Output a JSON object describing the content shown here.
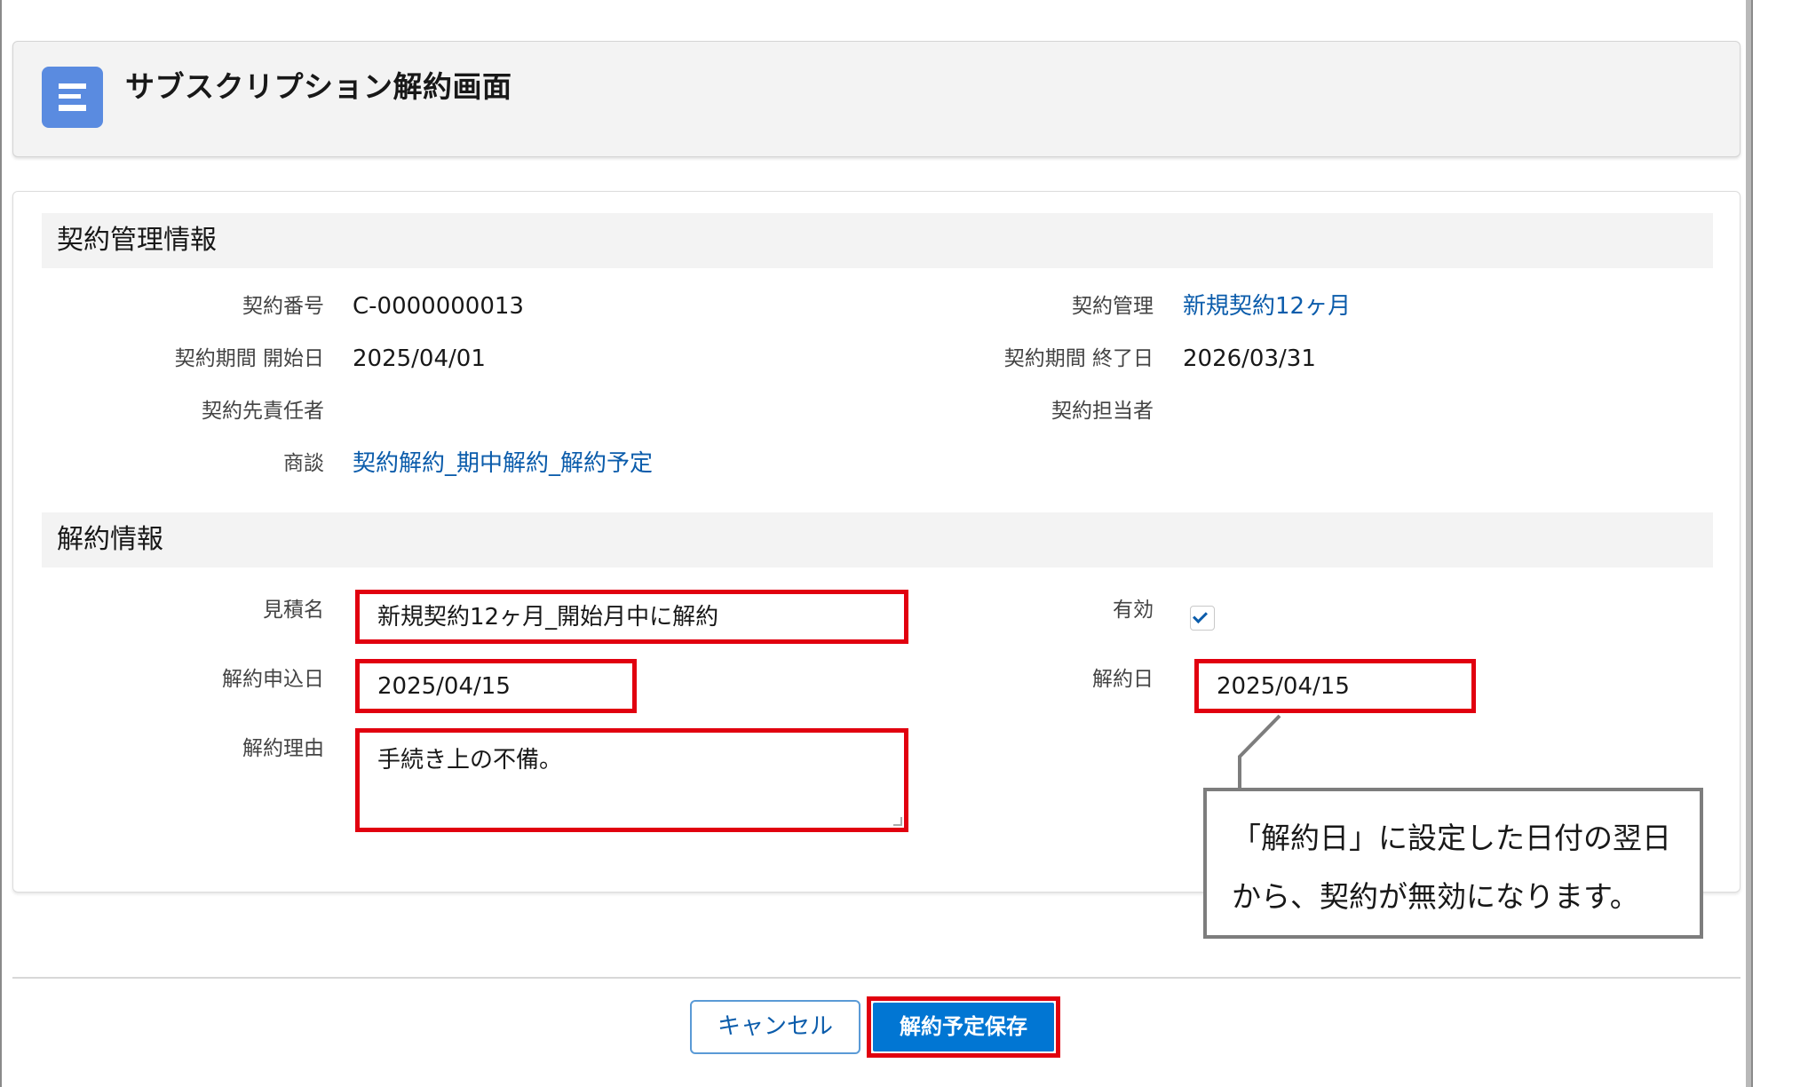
{
  "header": {
    "title": "サブスクリプション解約画面",
    "icon": "record-icon"
  },
  "contract_section": {
    "title": "契約管理情報",
    "fields": {
      "contract_number": {
        "label": "契約番号",
        "value": "C-0000000013"
      },
      "contract_management": {
        "label": "契約管理",
        "value": "新規契約12ヶ月"
      },
      "period_start": {
        "label": "契約期間 開始日",
        "value": "2025/04/01"
      },
      "period_end": {
        "label": "契約期間 終了日",
        "value": "2026/03/31"
      },
      "client_responsible": {
        "label": "契約先責任者",
        "value": ""
      },
      "contract_owner": {
        "label": "契約担当者",
        "value": ""
      },
      "opportunity": {
        "label": "商談",
        "value": "契約解約_期中解約_解約予定"
      }
    }
  },
  "cancel_section": {
    "title": "解約情報",
    "fields": {
      "quote_name": {
        "label": "見積名",
        "value": "新規契約12ヶ月_開始月中に解約"
      },
      "active": {
        "label": "有効",
        "checked": true
      },
      "application_date": {
        "label": "解約申込日",
        "value": "2025/04/15"
      },
      "cancel_date": {
        "label": "解約日",
        "value": "2025/04/15"
      },
      "reason": {
        "label": "解約理由",
        "value": "手続き上の不備。"
      }
    }
  },
  "callout": {
    "line1": "「解約日」に設定した日付の翌日",
    "line2": "から、契約が無効になります。"
  },
  "footer": {
    "cancel_label": "キャンセル",
    "save_label": "解約予定保存"
  },
  "colors": {
    "highlight": "#e1000f",
    "brand": "#0176d3",
    "link": "#0b5cab",
    "icon_bg": "#5a8be0"
  }
}
